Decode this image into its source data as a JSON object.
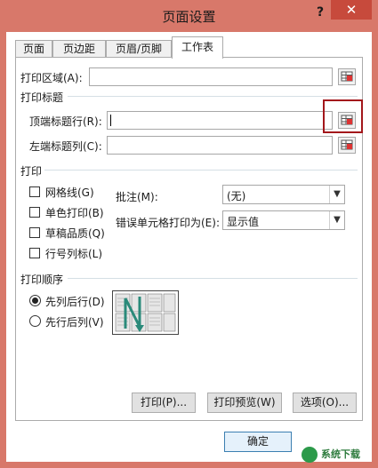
{
  "window": {
    "title": "页面设置",
    "help_glyph": "?",
    "close_glyph": "✕"
  },
  "tabs": [
    {
      "label": "页面"
    },
    {
      "label": "页边距"
    },
    {
      "label": "页眉/页脚"
    },
    {
      "label": "工作表",
      "active": true
    }
  ],
  "print_area": {
    "label": "打印区域(A):",
    "value": ""
  },
  "print_titles": {
    "group_label": "打印标题",
    "rows_label": "顶端标题行(R):",
    "rows_value": "",
    "cols_label": "左端标题列(C):",
    "cols_value": ""
  },
  "print": {
    "group_label": "打印",
    "gridlines": {
      "label": "网格线(G)",
      "checked": false
    },
    "black_white": {
      "label": "单色打印(B)",
      "checked": false
    },
    "draft": {
      "label": "草稿品质(Q)",
      "checked": false
    },
    "row_col_headers": {
      "label": "行号列标(L)",
      "checked": false
    },
    "comments_label": "批注(M):",
    "comments_value": "(无)",
    "errors_label": "错误单元格打印为(E):",
    "errors_value": "显示值"
  },
  "page_order": {
    "group_label": "打印顺序",
    "down_then_over": {
      "label": "先列后行(D)",
      "selected": true
    },
    "over_then_down": {
      "label": "先行后列(V)",
      "selected": false
    }
  },
  "buttons": {
    "print": "打印(P)...",
    "print_preview": "打印预览(W)",
    "options": "选项(O)...",
    "ok": "确定"
  },
  "watermark": {
    "text": "系统下载"
  },
  "colors": {
    "title_bar": "#d8786a",
    "close_button": "#c74a3c",
    "highlight_box": "#a3171b",
    "order_arrow": "#2a8a7a"
  }
}
